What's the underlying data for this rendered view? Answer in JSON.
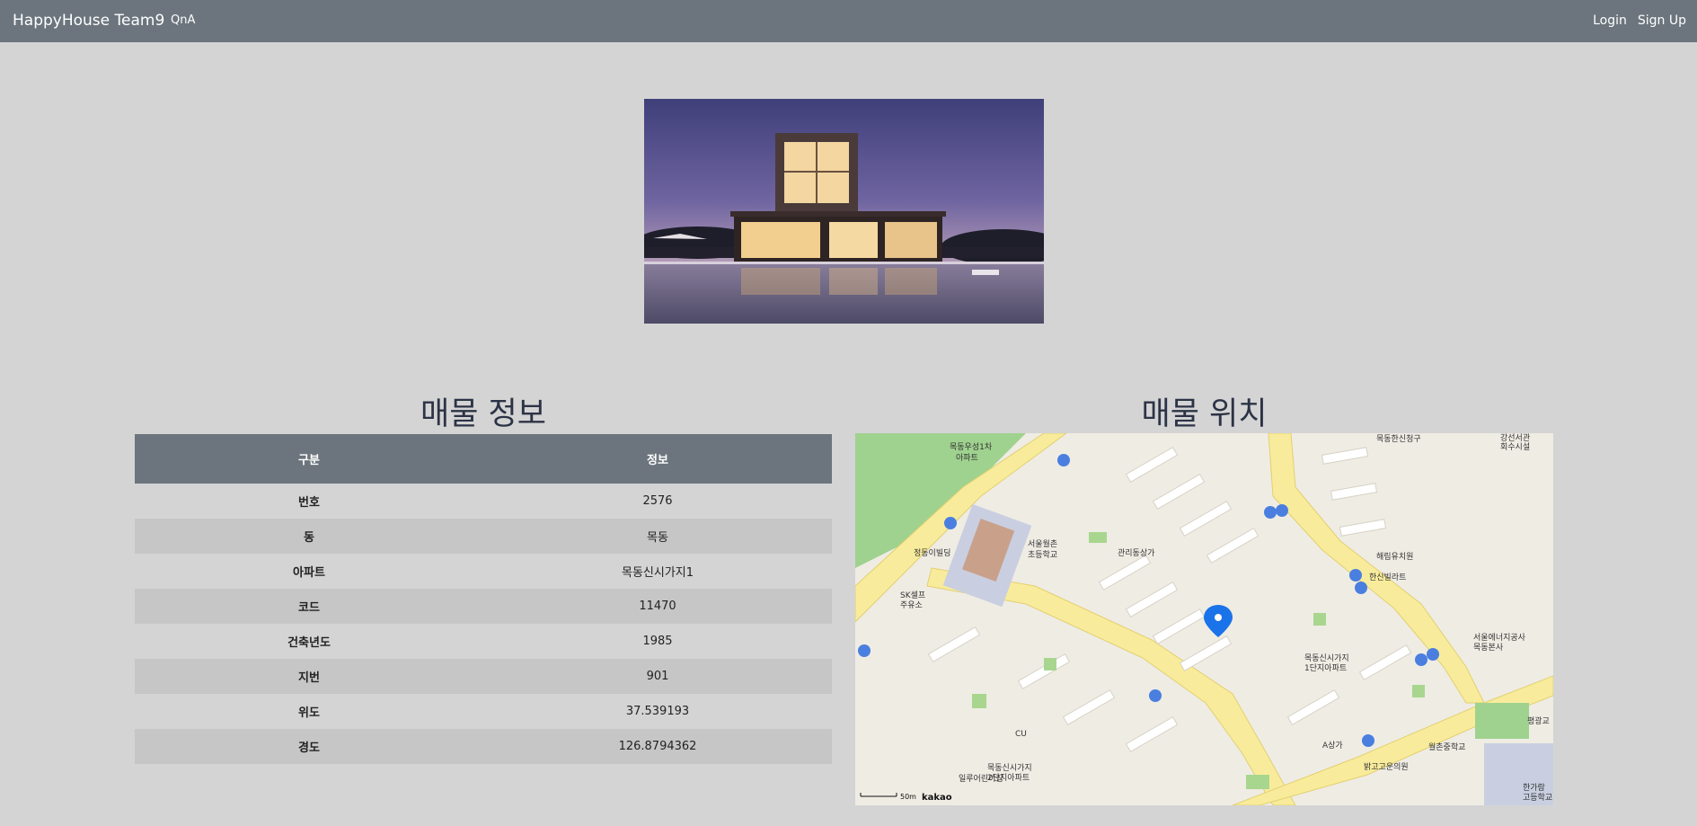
{
  "nav": {
    "brand": "HappyHouse Team9",
    "qna": "QnA",
    "login": "Login",
    "signup": "Sign Up"
  },
  "colors": {
    "navbar": "#6c757d",
    "page_bg": "#d4d4d4",
    "title": "#2c3346",
    "marker": "#1a73e8"
  },
  "info": {
    "title": "매물 정보",
    "headers": [
      "구분",
      "정보"
    ],
    "rows": [
      {
        "key": "번호",
        "value": "2576"
      },
      {
        "key": "동",
        "value": "목동"
      },
      {
        "key": "아파트",
        "value": "목동신시가지1"
      },
      {
        "key": "코드",
        "value": "11470"
      },
      {
        "key": "건축년도",
        "value": "1985"
      },
      {
        "key": "지번",
        "value": "901"
      },
      {
        "key": "위도",
        "value": "37.539193"
      },
      {
        "key": "경도",
        "value": "126.8794362"
      }
    ]
  },
  "map": {
    "title": "매물 위치",
    "logo": "kakao",
    "scale": "50m",
    "labels": [
      {
        "text": "목동우성1차"
      },
      {
        "text": "아파트"
      },
      {
        "text": "서울월촌"
      },
      {
        "text": "초등학교"
      },
      {
        "text": "관리동상가"
      },
      {
        "text": "정동이빌딩"
      },
      {
        "text": "SK셀프"
      },
      {
        "text": "주유소"
      },
      {
        "text": "해림유치원"
      },
      {
        "text": "한신빌라트"
      },
      {
        "text": "서울에너지공사"
      },
      {
        "text": "목동본사"
      },
      {
        "text": "목동신시가지"
      },
      {
        "text": "1단지아파트"
      },
      {
        "text": "목동한신청구"
      },
      {
        "text": "CU"
      },
      {
        "text": "A상가"
      },
      {
        "text": "월촌중학교"
      },
      {
        "text": "밝고고운의원"
      },
      {
        "text": "일루어린이집"
      },
      {
        "text": "목동신시가지"
      },
      {
        "text": "2단지아파트"
      },
      {
        "text": "한가람"
      },
      {
        "text": "고등학교"
      },
      {
        "text": "강선서관"
      },
      {
        "text": "회수시설"
      },
      {
        "text": "평광교"
      }
    ]
  }
}
